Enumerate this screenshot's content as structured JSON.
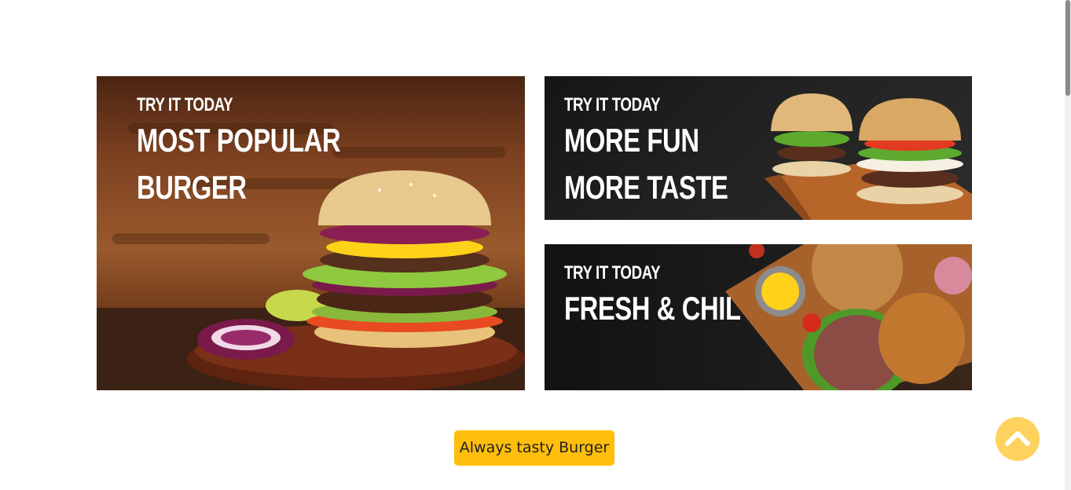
{
  "banners": [
    {
      "kicker": "Try it today",
      "lines": [
        "Most popular burger"
      ]
    },
    {
      "kicker": "Try it today",
      "lines": [
        "More fun",
        "More taste"
      ]
    },
    {
      "kicker": "Try it today",
      "lines": [
        "Fresh & Chil"
      ]
    }
  ],
  "tag_button": {
    "label": "Always tasty Burger"
  },
  "back_to_top": {
    "icon": "chevron-up-icon"
  },
  "colors": {
    "accent": "#ffbe0b",
    "back_to_top_bg": "#ffd25e"
  }
}
